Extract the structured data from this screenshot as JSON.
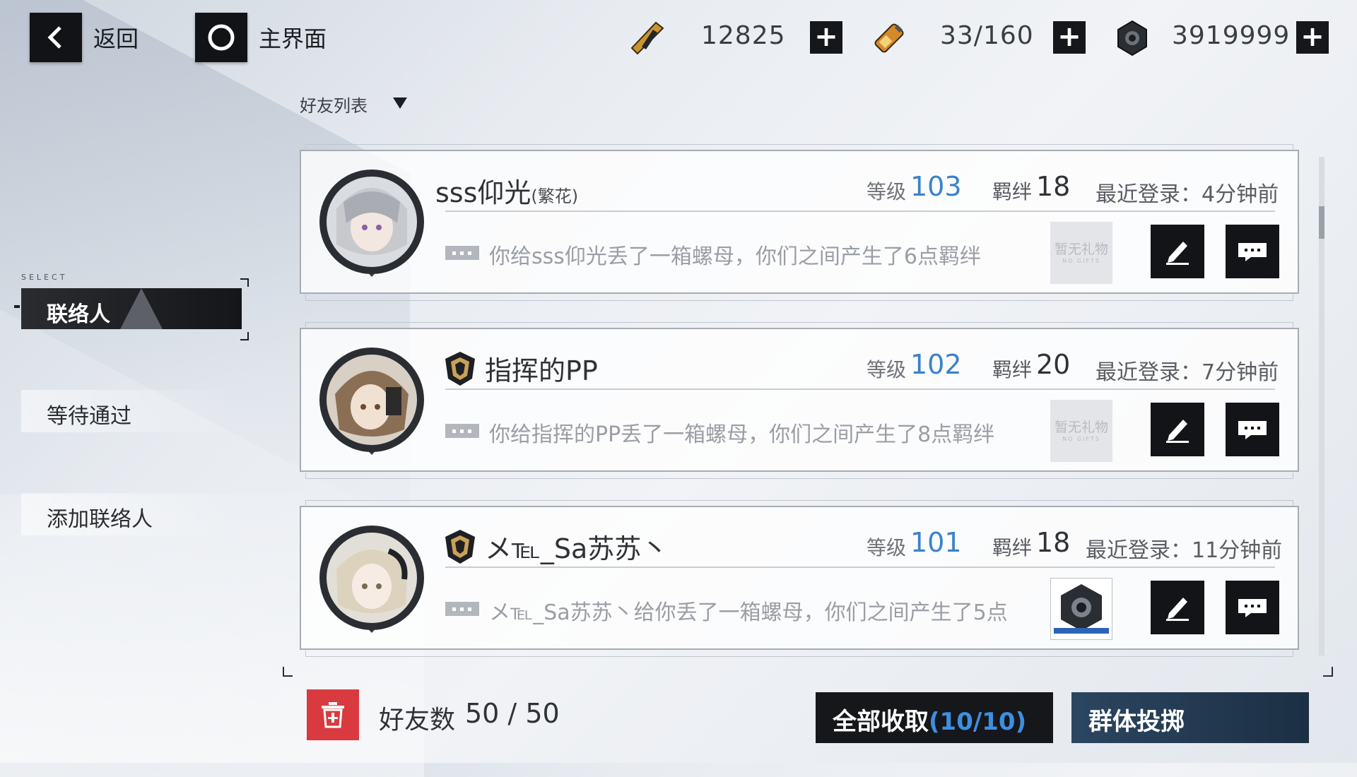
{
  "topbar": {
    "back_label": "返回",
    "home_label": "主界面",
    "resources": [
      {
        "icon": "ticket-icon",
        "value": "12825"
      },
      {
        "icon": "battery-icon",
        "value": "33/160"
      },
      {
        "icon": "nut-icon",
        "value": "3919999"
      }
    ],
    "add_symbol": "+"
  },
  "list_dropdown": {
    "label": "好友列表"
  },
  "sidebar": {
    "select_tag": "SELECT",
    "items": [
      {
        "label": "联络人",
        "active": true
      },
      {
        "label": "等待通过",
        "active": false
      },
      {
        "label": "添加联络人",
        "active": false
      }
    ]
  },
  "friends": [
    {
      "name": "sss仰光",
      "name_suffix": "(繁花)",
      "level_label": "等级",
      "level": "103",
      "bond_label": "羁绊",
      "bond": "18",
      "last_login": "最近登录：4分钟前",
      "message": "你给sss仰光丢了一箱螺母，你们之间产生了6点羁绊",
      "gift_text": "暂无礼物",
      "gift_sub": "NO GIFTS",
      "has_gift": false,
      "has_rank_icon": false
    },
    {
      "name": "指挥的PP",
      "name_suffix": "",
      "level_label": "等级",
      "level": "102",
      "bond_label": "羁绊",
      "bond": "20",
      "last_login": "最近登录：7分钟前",
      "message": "你给指挥的PP丢了一箱螺母，你们之间产生了8点羁绊",
      "gift_text": "暂无礼物",
      "gift_sub": "NO GIFTS",
      "has_gift": false,
      "has_rank_icon": true
    },
    {
      "name": "メ℡_Sa苏苏丶",
      "name_suffix": "",
      "level_label": "等级",
      "level": "101",
      "bond_label": "羁绊",
      "bond": "18",
      "last_login": "最近登录：11分钟前",
      "message": "メ℡_Sa苏苏丶给你丢了一箱螺母，你们之间产生了5点",
      "gift_text": "",
      "gift_sub": "",
      "has_gift": true,
      "has_rank_icon": true
    }
  ],
  "footer": {
    "friend_label": "好友数",
    "friend_count": "50 / 50",
    "collect_label": "全部收取",
    "collect_count": "(10/10)",
    "group_label": "群体投掷"
  },
  "colors": {
    "accent_blue": "#3b82c9",
    "delete_red": "#d93a3f",
    "group_btn": "#2b4661",
    "dark_btn": "#15171a"
  }
}
